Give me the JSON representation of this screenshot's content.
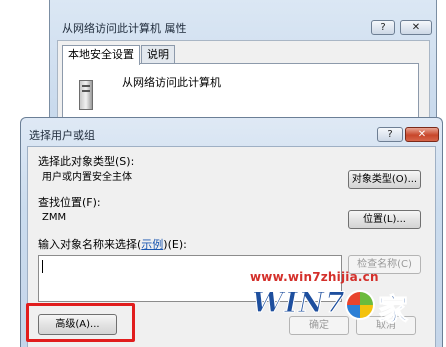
{
  "properties_window": {
    "title": "从网络访问此计算机 属性",
    "help_glyph": "?",
    "close_glyph": "✕",
    "tabs": [
      {
        "label": "本地安全设置",
        "active": true
      },
      {
        "label": "说明",
        "active": false
      }
    ],
    "policy_name": "从网络访问此计算机",
    "policy_icon": "server-icon"
  },
  "select_dialog": {
    "title": "选择用户或组",
    "help_glyph": "?",
    "close_glyph": "✕",
    "object_type_label": "选择此对象类型(S):",
    "object_type_value": "用户或内置安全主体",
    "object_types_button": "对象类型(O)...",
    "location_label": "查找位置(F):",
    "location_value": "ZMM",
    "locations_button": "位置(L)...",
    "names_label_prefix": "输入对象名称来选择(",
    "names_label_link": "示例",
    "names_label_suffix": ")(E):",
    "names_value": "",
    "check_names_button": "检查名称(C)",
    "advanced_button": "高级(A)...",
    "ok_button": "确定",
    "cancel_button": "取消",
    "highlight_color": "#e11d1d"
  },
  "watermark": {
    "url": "www.win7zhijia.cn",
    "logo_text": "WIN7",
    "logo_char": "家",
    "colors": [
      "#e8442c",
      "#6cbb3c",
      "#2b7fd6",
      "#f4c20d"
    ]
  }
}
